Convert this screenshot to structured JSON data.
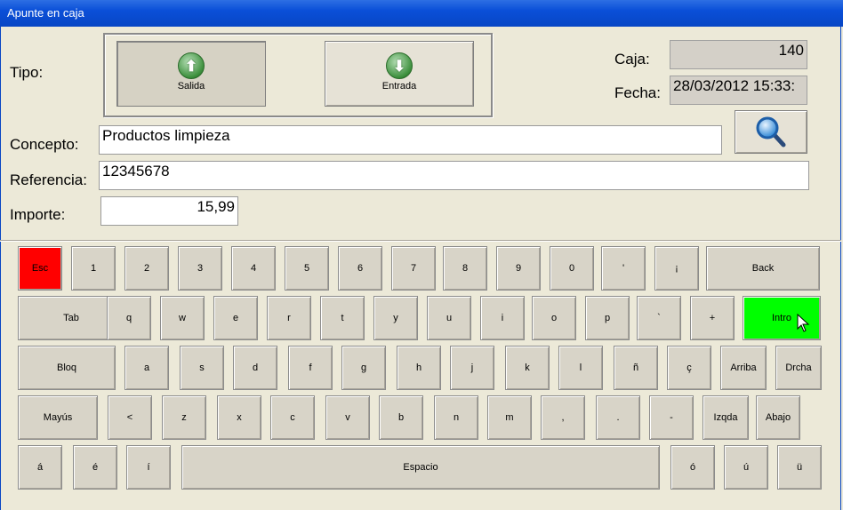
{
  "window": {
    "title": "Apunte en caja"
  },
  "form": {
    "tipo_label": "Tipo:",
    "salida_label": "Salida",
    "entrada_label": "Entrada",
    "caja_label": "Caja:",
    "caja_value": "140",
    "fecha_label": "Fecha:",
    "fecha_value": "28/03/2012 15:33:",
    "concepto_label": "Concepto:",
    "concepto_value": "Productos limpieza",
    "referencia_label": "Referencia:",
    "referencia_value": "12345678",
    "importe_label": "Importe:",
    "importe_value": "15,99"
  },
  "keyboard": {
    "rows": [
      [
        "Esc",
        "1",
        "2",
        "3",
        "4",
        "5",
        "6",
        "7",
        "8",
        "9",
        "0",
        "'",
        "¡",
        "Back"
      ],
      [
        "Tab",
        "q",
        "w",
        "e",
        "r",
        "t",
        "y",
        "u",
        "i",
        "o",
        "p",
        "`",
        "+",
        "Intro"
      ],
      [
        "Bloq",
        "a",
        "s",
        "d",
        "f",
        "g",
        "h",
        "j",
        "k",
        "l",
        "ñ",
        "ç",
        "Arriba",
        "Drcha"
      ],
      [
        "Mayús",
        "<",
        "z",
        "x",
        "c",
        "v",
        "b",
        "n",
        "m",
        ",",
        ".",
        "-",
        "Izqda",
        "Abajo"
      ],
      [
        "á",
        "é",
        "í",
        "Espacio",
        "ó",
        "ú",
        "ü"
      ]
    ]
  },
  "colors": {
    "esc": "#ff0000",
    "intro": "#00ff00",
    "title_bar": "#0a4fd8"
  },
  "icons": {
    "salida": "arrow-up-icon",
    "entrada": "arrow-down-icon",
    "search": "magnifier-icon"
  }
}
